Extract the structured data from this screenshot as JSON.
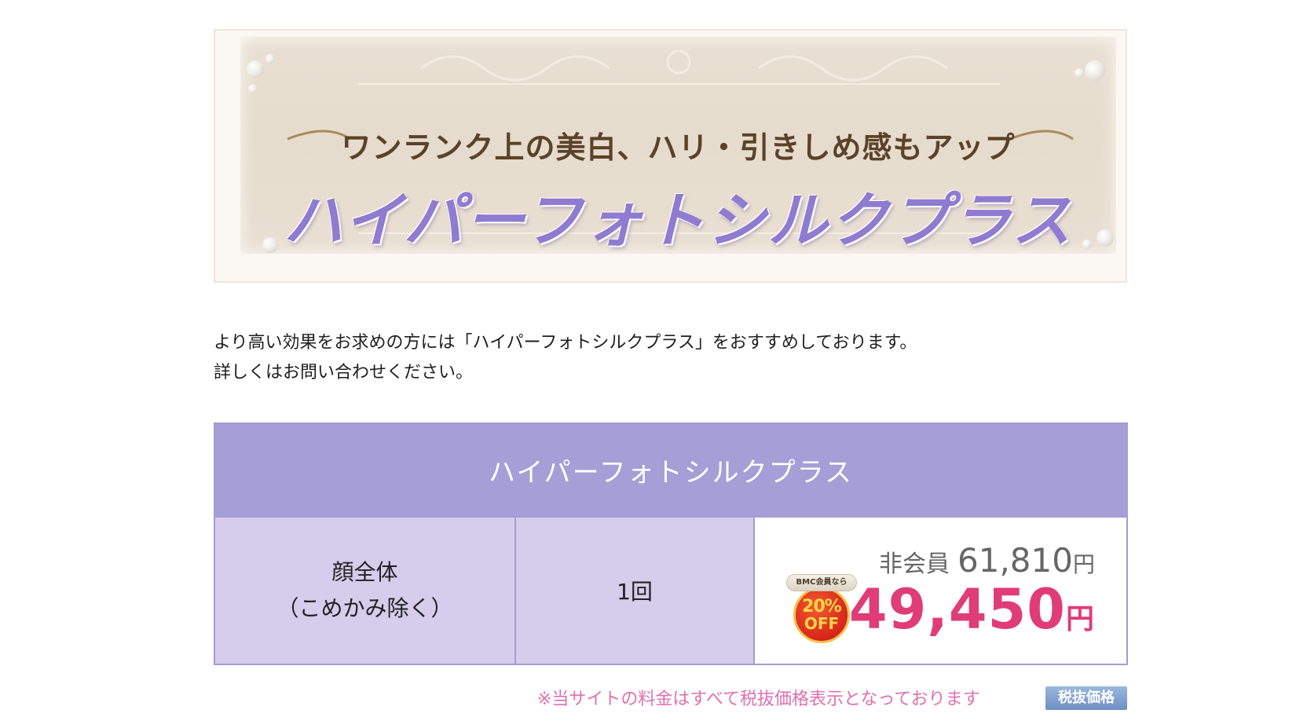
{
  "banner": {
    "subtitle": "ワンランク上の美白、ハリ・引きしめ感もアップ",
    "title": "ハイパーフォトシルクプラス"
  },
  "description": {
    "line1": "より高い効果をお求めの方には「ハイパーフォトシルクプラス」をおすすめしております。",
    "line2": "詳しくはお問い合わせください。"
  },
  "price_table": {
    "header": "ハイパーフォトシルクプラス",
    "area_line1": "顔全体",
    "area_line2": "（こめかみ除く）",
    "count": "1回",
    "nonmember_label": "非会員",
    "nonmember_price": "61,810",
    "member_price": "49,450",
    "yen": "円",
    "badge_top": "BMC会員なら",
    "badge_percent": "20%",
    "badge_off": "OFF"
  },
  "footer": {
    "tax_note": "※当サイトの料金はすべて税抜価格表示となっております",
    "tax_badge": "税抜価格"
  },
  "colors": {
    "header_bg": "#a69ed6",
    "cell_bg": "#d5cdeb",
    "member_price": "#e03c78",
    "tax_note": "#e070b0"
  }
}
